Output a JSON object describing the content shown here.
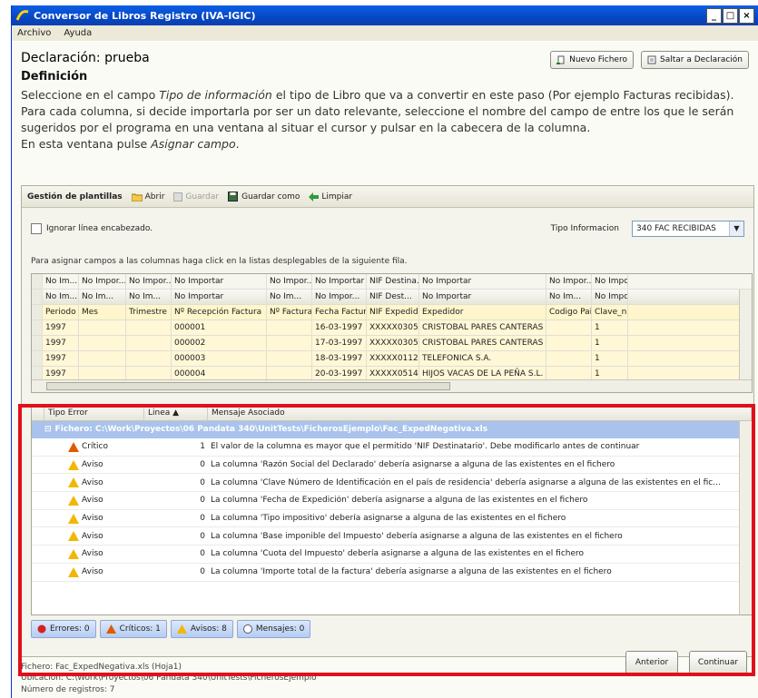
{
  "window": {
    "title": "Conversor de Libros Registro (IVA-IGIC)",
    "min": "_",
    "max": "□",
    "close": "×"
  },
  "menu": [
    "Archivo",
    "Ayuda"
  ],
  "header": {
    "declaracion": "Declaración: prueba",
    "nuevo_fichero": "Nuevo Fichero",
    "saltar": "Saltar a Declaración",
    "definicion": "Definición"
  },
  "description": {
    "p1_a": "Seleccione en el campo ",
    "p1_em": "Tipo de información",
    "p1_b": " el tipo de Libro que va a convertir en este paso (Por ejemplo Facturas recibidas). Para cada columna, si decide importarla por ser un dato relevante, seleccione el nombre del campo de entre los que le serán sugeridos por el programa en una ventana al situar el cursor y pulsar en la cabecera de la columna.",
    "p2_a": "En esta ventana pulse ",
    "p2_em": "Asignar campo",
    "p2_b": "."
  },
  "templates": {
    "label": "Gestión de plantillas",
    "abrir": "Abrir",
    "guardar": "Guardar",
    "guardar_como": "Guardar como",
    "limpiar": "Limpiar"
  },
  "options": {
    "ignorar": "Ignorar línea encabezado.",
    "tipo_label": "Tipo Informacion",
    "tipo_value": "340 FAC RECIBIDAS",
    "assign_note": "Para asignar campos a las columnas haga click en la listas desplegables de la siguiente fila."
  },
  "grid1": {
    "combos": [
      "No Im...",
      "No Impor...",
      "No Impor...",
      "No Importar",
      "No Impor...",
      "No Importar",
      "NIF Destina...",
      "No Importar",
      "No Impor...",
      "No Import"
    ],
    "headers": [
      "No Im...",
      "No Im...",
      "No Im...",
      "No Importar",
      "No Im...",
      "No Impor...",
      "NIF Dest...",
      "No Importar",
      "No Im...",
      "No Import"
    ],
    "fields": [
      "Periodo",
      "Mes",
      "Trimestre",
      "Nº Recepción Factura",
      "Nº Factura",
      "Fecha Factura",
      "NIF Expedidor",
      "Expedidor",
      "Codigo Pais",
      "Clave_nu"
    ],
    "rows": [
      [
        "1997",
        "",
        "",
        "000001",
        "",
        "16-03-1997",
        "XXXXX0305",
        "CRISTOBAL PARES CANTERAS",
        "",
        "1"
      ],
      [
        "1997",
        "",
        "",
        "000002",
        "",
        "17-03-1997",
        "XXXXX0305",
        "CRISTOBAL PARES CANTERAS",
        "",
        "1"
      ],
      [
        "1997",
        "",
        "",
        "000003",
        "",
        "18-03-1997",
        "XXXXX0112",
        "TELEFONICA S.A.",
        "",
        "1"
      ],
      [
        "1997",
        "",
        "",
        "000004",
        "",
        "20-03-1997",
        "XXXXX0514",
        "HIJOS VACAS DE LA PEÑA S.L.",
        "",
        "1"
      ]
    ]
  },
  "grid2": {
    "headers": [
      "Tipo Error",
      "Linea",
      "Mensaje Asociado"
    ],
    "group": "Fichero: C:\\Work\\Proyectos\\06 Pandata 340\\UnitTests\\FicherosEjemplo\\Fac_ExpedNegativa.xls",
    "rows": [
      {
        "tipo": "Crítico",
        "linea": "1",
        "msg": "El valor de la columna es mayor que el permitido 'NIF Destinatario'. Debe modificarlo antes de continuar"
      },
      {
        "tipo": "Aviso",
        "linea": "0",
        "msg": "La columna 'Razón Social del Declarado' debería asignarse a alguna de las existentes en el fichero"
      },
      {
        "tipo": "Aviso",
        "linea": "0",
        "msg": "La columna 'Clave Número de Identificación en el país de residencia' debería asignarse a alguna de las existentes en el fic..."
      },
      {
        "tipo": "Aviso",
        "linea": "0",
        "msg": "La columna 'Fecha de Expedición' debería asignarse a alguna de las existentes en el fichero"
      },
      {
        "tipo": "Aviso",
        "linea": "0",
        "msg": "La columna 'Tipo impositivo' debería asignarse a alguna de las existentes en el fichero"
      },
      {
        "tipo": "Aviso",
        "linea": "0",
        "msg": "La columna 'Base imponible del Impuesto' debería asignarse a alguna de las existentes en el fichero"
      },
      {
        "tipo": "Aviso",
        "linea": "0",
        "msg": "La columna 'Cuota del Impuesto' debería asignarse a alguna de las existentes en el fichero"
      },
      {
        "tipo": "Aviso",
        "linea": "0",
        "msg": "La columna 'Importe total de la factura' debería asignarse a alguna de las existentes en el fichero"
      }
    ]
  },
  "tabs": {
    "errores": "Errores: 0",
    "criticos": "Críticos: 1",
    "avisos": "Avisos: 8",
    "mensajes": "Mensajes: 0"
  },
  "footer": {
    "fichero": "Fichero: Fac_ExpedNegativa.xls (Hoja1)",
    "ubicacion": "Ubicación: C:\\Work\\Proyectos\\06 Pandata 340\\UnitTests\\FicherosEjemplo",
    "registros": "Número de registros: 7",
    "anterior": "Anterior",
    "continuar": "Continuar"
  },
  "colors": {
    "highlight": "#e0101c",
    "group_row": "#a9c3ec",
    "warning": "#f2b705"
  }
}
